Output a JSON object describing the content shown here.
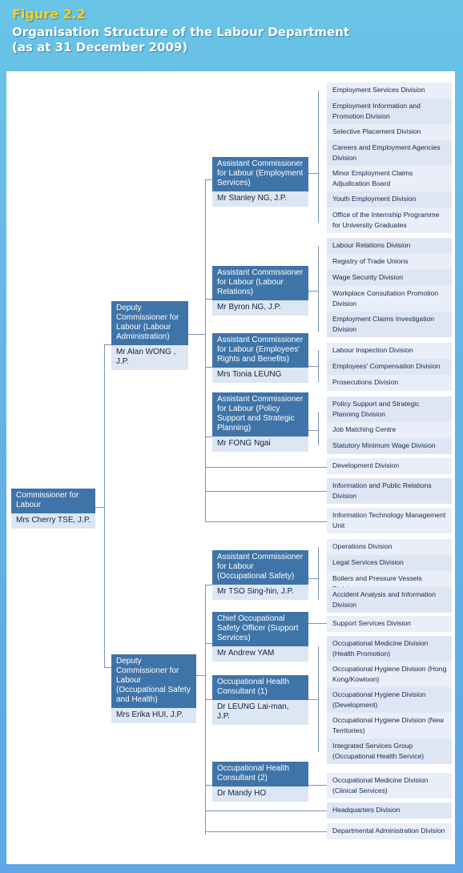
{
  "header": {
    "figure_label": "Figure 2.2",
    "title_line1": "Organisation Structure of the Labour Department",
    "title_line2": "(as at 31 December 2009)"
  },
  "colors": {
    "background": "#62b3e4",
    "figure_label": "#ffd21a",
    "box_title": "#3f74a8",
    "box_name": "#dde6f3",
    "division": "#e9eef8",
    "connector": "#7c94b4"
  },
  "commissioner": {
    "title": "Commissioner for Labour",
    "name": "Mrs Cherry TSE, J.P."
  },
  "deputies": [
    {
      "title": "Deputy Commissioner for Labour (Labour Administration)",
      "name": "Mr Alan WONG , J.P."
    },
    {
      "title": "Deputy Commissioner for Labour (Occupational Safety and Health)",
      "name": "Mrs Erika HUI, J.P."
    }
  ],
  "heads": [
    {
      "title": "Assistant Commissioner for Labour (Employment Services)",
      "name": "Mr Stanley NG, J.P.",
      "divisions": [
        "Employment Services Division",
        "Employment Information and Promotion Division",
        "Selective Placement Division",
        "Careers and Employment Agencies Division",
        "Minor Employment Claims Adjudication Board",
        "Youth Employment Division",
        "Office of the Internship Programme for University Graduates"
      ]
    },
    {
      "title": "Assistant Commissioner for Labour (Labour Relations)",
      "name": "Mr Byron NG, J.P.",
      "divisions": [
        "Labour Relations Division",
        "Registry of Trade Unions",
        "Wage Security Division",
        "Workplace Consultation Promotion Division",
        "Employment Claims Investigation Division"
      ]
    },
    {
      "title": "Assistant Commissioner for Labour (Employees' Rights and Benefits)",
      "name": "Mrs Tonia LEUNG",
      "divisions": [
        "Labour Inspection Division",
        "Employees' Compensation Division",
        "Prosecutions Division"
      ]
    },
    {
      "title": "Assistant Commissioner for Labour (Policy Support and Strategic Planning)",
      "name": "Mr FONG Ngai",
      "divisions": [
        "Policy Support and Strategic Planning Division",
        "Job Matching Centre",
        "Statutory Minimum Wage Division"
      ]
    },
    {
      "title": "Assistant Commissioner for Labour (Occupational Safety)",
      "name": "Mr TSO Sing-hin, J.P.",
      "divisions": [
        "Operations Division",
        "Legal Services Division",
        "Boilers and Pressure Vessels Division",
        "Accident Analysis and Information Division"
      ]
    },
    {
      "title": "Chief Occupational Safety Officer (Support Services)",
      "name": "Mr Andrew YAM",
      "divisions": [
        "Support Services Division"
      ]
    },
    {
      "title": "Occupational Health Consultant (1)",
      "name": "Dr LEUNG Lai-man, J.P.",
      "divisions": [
        "Occupational Medicine Division (Health Promotion)",
        "Occupational Hygiene Division (Hong Kong/Kowloon)",
        "Occupational Hygiene Division (Development)",
        "Occupational Hygiene Division (New Territories)",
        "Integrated Services Group (Occupational Health Service)"
      ]
    },
    {
      "title": "Occupational Health Consultant (2)",
      "name": "Dr Mandy HO",
      "divisions": [
        "Occupational Medicine Division (Clinical Services)"
      ]
    }
  ],
  "direct_divisions_la": [
    "Development Division",
    "Information and Public Relations Division",
    "Information Technology Management Unit"
  ],
  "direct_divisions_osh": [
    "Headquarters Division",
    "Departmental Administration Division"
  ]
}
